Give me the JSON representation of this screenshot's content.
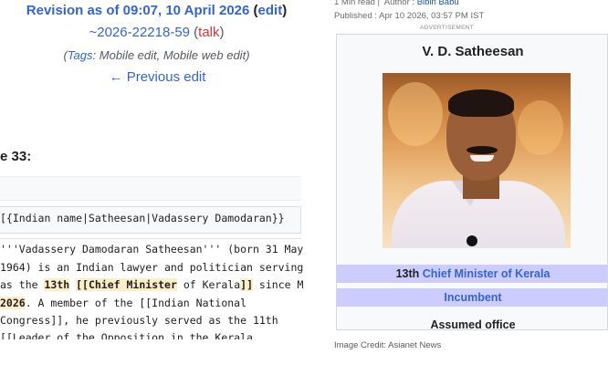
{
  "wiki_diff": {
    "revision_prefix": "Revision as of 09:07, 10 April 2026",
    "edit_link": "edit",
    "user_link": "~2026-22218-59",
    "talk_link": "talk",
    "tags_label": "Tags",
    "tags_value": "Mobile edit, Mobile web edit",
    "previous_edit": "← Previous edit",
    "line_header": "e 33:",
    "context_line": "[{Indian name|Satheesan|Vadassery Damodaran}}",
    "lines": {
      "l1": "'''Vadassery Damodaran Satheesan''' (born 31 May",
      "l2": "1964) is an Indian lawyer and politician serving",
      "l3_a": "as the ",
      "l3_b": "13th",
      "l3_c": " ",
      "l3_d": "[[Chief Minister",
      "l3_e": " of Kerala",
      "l3_f": "]]",
      "l3_g": " since Ma",
      "l4_a": "2026",
      "l4_b": ". A member of the [[Indian National",
      "l5": "Congress]], he previously served as the 11th",
      "l6": "[[Leader of the Opposition in the Kerala"
    }
  },
  "article": {
    "read_time": "1 Min read",
    "author_label": "Author :",
    "author_name": "Bibin Babu",
    "published": "Published : Apr 10 2026, 03:57 PM IST",
    "advertisement": "ADVERTISEMENT",
    "infobox": {
      "name": "V. D. Satheesan",
      "office_ordinal": "13th",
      "office_link": "Chief Minister of Kerala",
      "incumbent": "Incumbent",
      "assumed_office": "Assumed office"
    },
    "image_credit": "Image Credit: Asianet News"
  }
}
